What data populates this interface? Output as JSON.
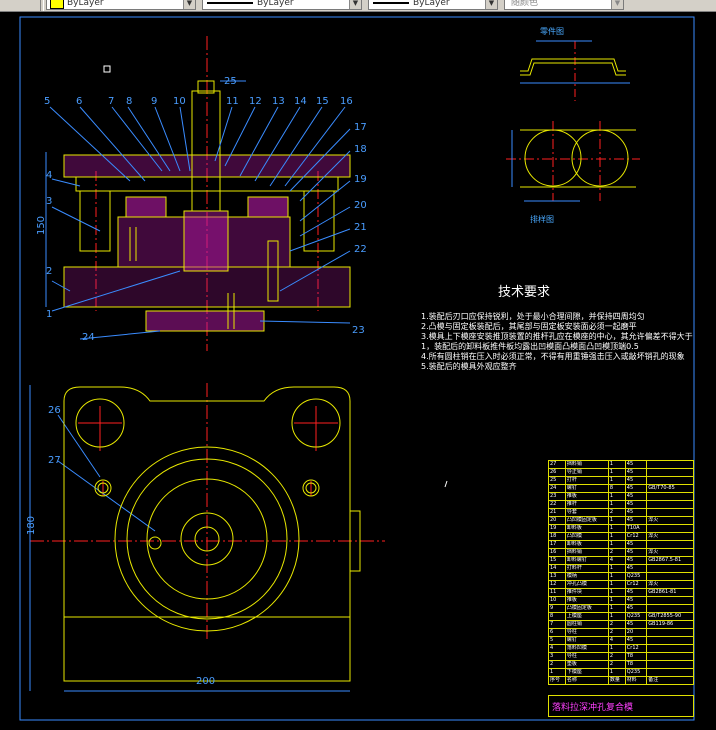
{
  "toolbar": {
    "color_value": "ByLayer",
    "linetype_value": "ByLayer",
    "lineweight_value": "ByLayer",
    "plotstyle_value": "随颜色"
  },
  "drawing": {
    "tech_title": "技术要求",
    "tech_notes": [
      "1.装配后刃口应保持锐利，处于最小合理间隙，并保持四周均匀",
      "2.凸模与固定板装配后，其尾部与固定板安装面必须一起磨平",
      "3.模具上下模座安装推顶装置的推杆孔应在模座的中心，其允许偏差不得大于1，装配后的卸料板推件板均露出凹模面凸模面凸凹模顶端0.5",
      "4.所有圆柱销在压入时必须正常，不得有用重锤强击压入或敲坏销孔的现象",
      "5.装配后的模具外观应整齐"
    ],
    "part_drawing_label": "零件图",
    "blank_drawing_label": "排样图",
    "dims": {
      "height": "150",
      "width": "200",
      "height2": "180"
    },
    "part_numbers_top": [
      "5",
      "6",
      "7",
      "8",
      "9",
      "10",
      "11",
      "12",
      "13",
      "14",
      "15",
      "16"
    ],
    "part_numbers_right": [
      "17",
      "18",
      "19",
      "20",
      "21",
      "22",
      "23"
    ],
    "part_numbers_left": [
      "4",
      "3",
      "2",
      "1"
    ],
    "part_number_25": "25",
    "part_number_24": "24",
    "part_numbers_plan": [
      "26",
      "27"
    ]
  },
  "bom": {
    "rows": [
      [
        "27",
        "挡料销",
        "1",
        "45",
        ""
      ],
      [
        "26",
        "导正销",
        "1",
        "45",
        ""
      ],
      [
        "25",
        "打杆",
        "1",
        "45",
        ""
      ],
      [
        "24",
        "螺钉",
        "8",
        "45",
        "GB/T70-85"
      ],
      [
        "23",
        "推板",
        "1",
        "45",
        ""
      ],
      [
        "22",
        "推杆",
        "1",
        "45",
        ""
      ],
      [
        "21",
        "导套",
        "2",
        "45",
        ""
      ],
      [
        "20",
        "凸凹模固定板",
        "1",
        "45",
        "淬火"
      ],
      [
        "19",
        "卸料板",
        "1",
        "T10A",
        ""
      ],
      [
        "18",
        "凸凹模",
        "1",
        "Cr12",
        "淬火"
      ],
      [
        "17",
        "卸料板",
        "1",
        "45",
        ""
      ],
      [
        "16",
        "挡料销",
        "2",
        "45",
        "淬火"
      ],
      [
        "15",
        "卸料螺钉",
        "4",
        "45",
        "GB2867.5-81"
      ],
      [
        "14",
        "打料杆",
        "1",
        "45",
        ""
      ],
      [
        "13",
        "模柄",
        "1",
        "Q235",
        ""
      ],
      [
        "12",
        "冲孔凸模",
        "1",
        "Cr12",
        "淬火"
      ],
      [
        "11",
        "推件块",
        "1",
        "45",
        "GB2861-81"
      ],
      [
        "10",
        "推板",
        "1",
        "45",
        ""
      ],
      [
        "9",
        "凸模固定板",
        "1",
        "45",
        ""
      ],
      [
        "8",
        "上模座",
        "1",
        "Q235",
        "GB/T2855-90"
      ],
      [
        "7",
        "圆柱销",
        "2",
        "45",
        "GB119-86"
      ],
      [
        "6",
        "导柱",
        "2",
        "20",
        ""
      ],
      [
        "5",
        "螺钉",
        "4",
        "45",
        ""
      ],
      [
        "4",
        "落料凹模",
        "1",
        "Cr12",
        ""
      ],
      [
        "3",
        "导柱",
        "2",
        "T8",
        ""
      ],
      [
        "2",
        "垫板",
        "2",
        "T8",
        ""
      ],
      [
        "1",
        "下模座",
        "1",
        "Q235",
        ""
      ]
    ],
    "header": [
      "序号",
      "名称",
      "数量",
      "材料",
      "备注"
    ],
    "title": "落料拉深冲孔复合模"
  },
  "colors": {
    "yellow": "#e8e800",
    "cyan": "#3a8cff",
    "magenta": "#ff3cff",
    "red": "#ff2020",
    "white": "#ffffff"
  }
}
